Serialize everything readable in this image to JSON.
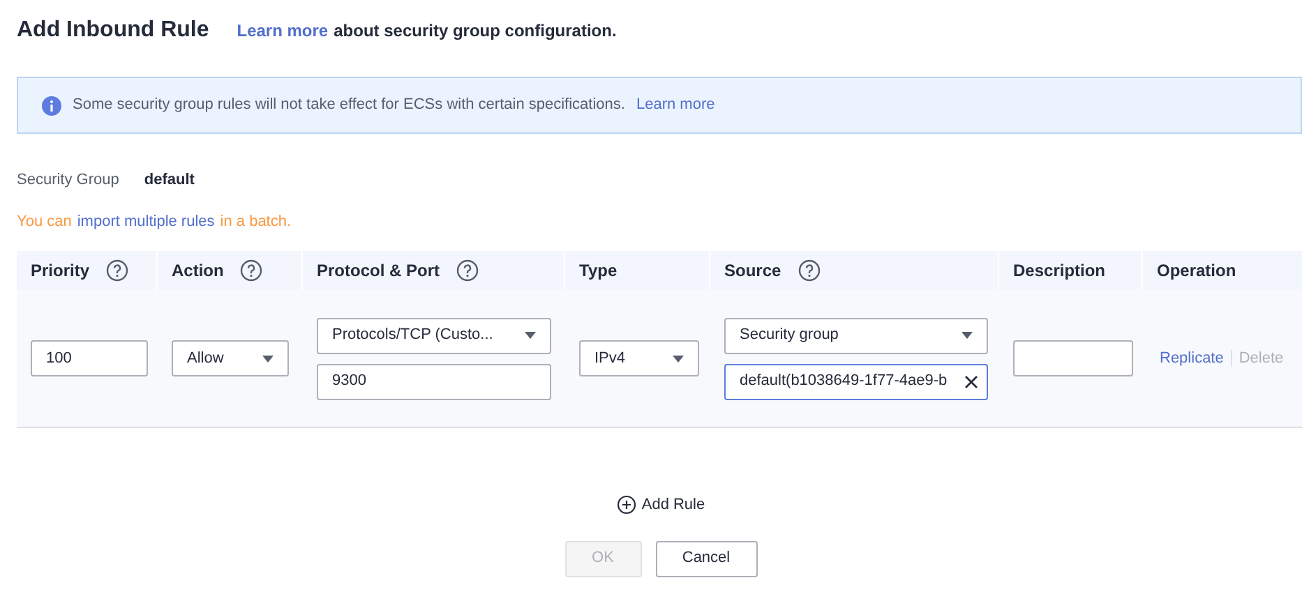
{
  "header": {
    "title": "Add Inbound Rule",
    "link": "Learn more",
    "text": "about security group configuration."
  },
  "notice": {
    "text": "Some security group rules will not take effect for ECSs with certain specifications.",
    "link": "Learn more"
  },
  "security_group": {
    "label": "Security Group",
    "value": "default"
  },
  "import_hint": {
    "prefix": "You can",
    "link": "import multiple rules",
    "suffix": "in a batch."
  },
  "table": {
    "columns": [
      {
        "label": "Priority",
        "help": true
      },
      {
        "label": "Action",
        "help": true
      },
      {
        "label": "Protocol & Port",
        "help": true
      },
      {
        "label": "Type",
        "help": false
      },
      {
        "label": "Source",
        "help": true
      },
      {
        "label": "Description",
        "help": false
      },
      {
        "label": "Operation",
        "help": false
      }
    ],
    "rows": [
      {
        "priority": "100",
        "action": "Allow",
        "protocol": "Protocols/TCP (Custo...",
        "port": "9300",
        "type": "IPv4",
        "source_type": "Security group",
        "source": "default(b1038649-1f77-4ae9-b",
        "source_focused": true,
        "description": "",
        "operations": [
          {
            "label": "Replicate",
            "disabled": false
          },
          {
            "label": "Delete",
            "disabled": true
          }
        ]
      }
    ]
  },
  "add_rule": "Add Rule",
  "buttons": [
    {
      "label": "OK",
      "disabled": true
    },
    {
      "label": "Cancel",
      "disabled": false
    }
  ]
}
